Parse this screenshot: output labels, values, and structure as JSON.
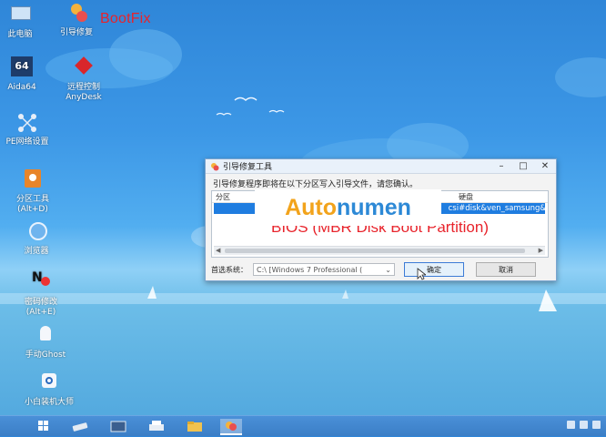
{
  "desktop": {
    "icons": [
      {
        "label": "此电脑",
        "sub": ""
      },
      {
        "label": "引导修复",
        "sub": ""
      },
      {
        "label": "Aida64",
        "sub": ""
      },
      {
        "label": "远程控制",
        "sub": "AnyDesk"
      },
      {
        "label": "PE网络设置",
        "sub": ""
      },
      {
        "label": "分区工具",
        "sub": "(Alt+D)"
      },
      {
        "label": "浏览器",
        "sub": ""
      },
      {
        "label": "密码修改",
        "sub": "(Alt+E)"
      },
      {
        "label": "手动Ghost",
        "sub": ""
      },
      {
        "label": "小白装机大师",
        "sub": ""
      }
    ],
    "aida_text": "64",
    "bootfix_label": "BootFix"
  },
  "dialog": {
    "title": "引导修复工具",
    "message": "引导修复程序即将在以下分区写入引导文件，请您确认。",
    "columns": [
      "分区",
      "硬盘"
    ],
    "disk_id": "csi#disk&ven_samsung&",
    "partition_type": "BIOS (MBR Disk Boot Partition)",
    "system_label": "首选系统：",
    "system_value": "C:\\ [Windows 7 Professional (",
    "ok_label": "确定",
    "cancel_label": "取消",
    "minimize": "–",
    "maximize": "□",
    "close": "✕"
  },
  "watermark": {
    "part1": "Auto",
    "part2": "numen"
  },
  "colors": {
    "accent_red": "#e8232b",
    "selection": "#1f7de0",
    "watermark_orange": "#f2a31b",
    "watermark_blue": "#2d89d6"
  }
}
